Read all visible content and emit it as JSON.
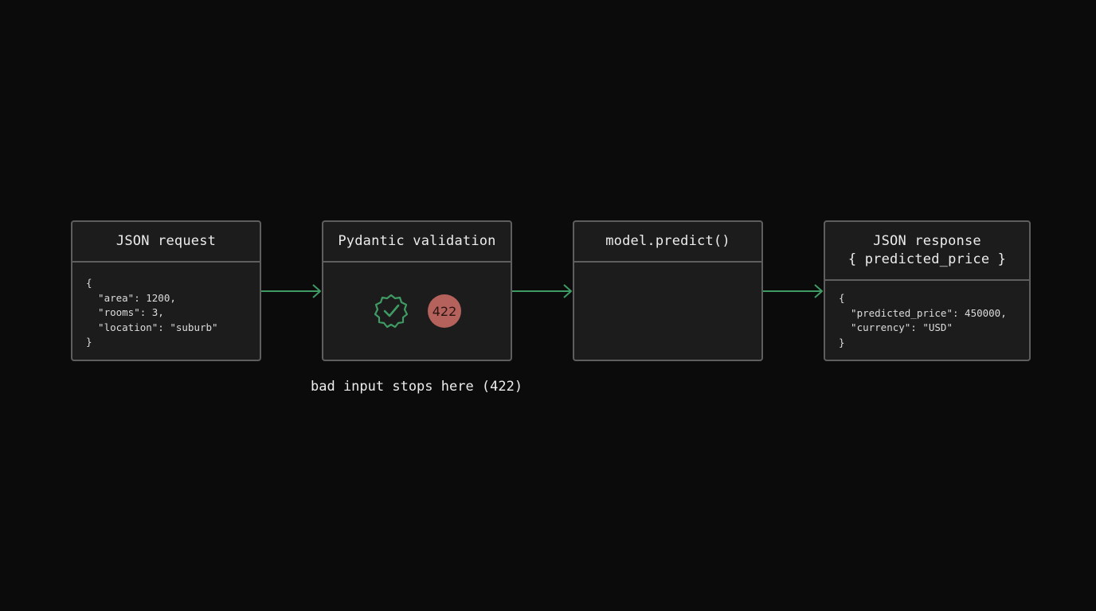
{
  "colors": {
    "background": "#0b0b0b",
    "box_fill": "#1c1c1c",
    "box_border": "#5e5e5e",
    "arrow": "#3f9a64",
    "check": "#3f9a64",
    "error_badge": "#b5625c"
  },
  "steps": [
    {
      "title_lines": [
        "JSON request"
      ],
      "body_lines": [
        "{",
        "  \"area\": 1200,",
        "  \"rooms\": 3,",
        "  \"location\": \"suburb\"",
        "}"
      ]
    },
    {
      "title_lines": [
        "Pydantic validation"
      ],
      "icons": [
        "check-badge-icon"
      ],
      "badge": "422"
    },
    {
      "title_lines": [
        "model.predict()"
      ]
    },
    {
      "title_lines": [
        "JSON response",
        "{ predicted_price }"
      ],
      "body_lines": [
        "{",
        "  \"predicted_price\": 450000,",
        "  \"currency\": \"USD\"",
        "}"
      ]
    }
  ],
  "caption": "bad input stops here (422)"
}
